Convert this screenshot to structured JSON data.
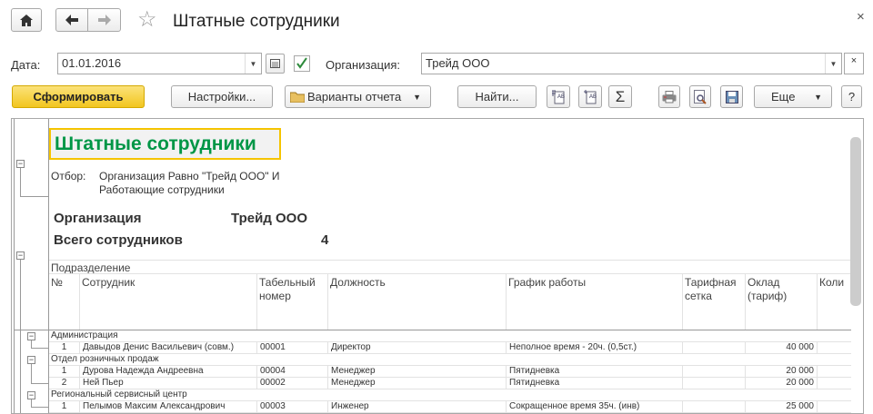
{
  "window": {
    "title": "Штатные сотрудники",
    "close": "×"
  },
  "icons": {
    "home": "home-icon",
    "back": "arrow-left-icon",
    "forward": "arrow-right-icon",
    "favorite": "star-icon"
  },
  "filters": {
    "date_label": "Дата:",
    "date_value": "01.01.2016",
    "org_checked": true,
    "org_label": "Организация:",
    "org_value": "Трейд ООО",
    "clear": "×"
  },
  "toolbar": {
    "generate": "Сформировать",
    "settings": "Настройки...",
    "variants": "Варианты отчета",
    "find": "Найти...",
    "more": "Еще",
    "help": "?",
    "accent": "#f5cd2c"
  },
  "report": {
    "title": "Штатные сотрудники",
    "title_color": "#009646",
    "filter_label": "Отбор:",
    "filter_line1": "Организация Равно \"Трейд ООО\" И",
    "filter_line2": "Работающие сотрудники",
    "org_label": "Организация",
    "org_value": "Трейд ООО",
    "total_label": "Всего сотрудников",
    "total_value": "4",
    "group_header": "Подразделение",
    "columns": [
      "№",
      "Сотрудник",
      "Табельный номер",
      "Должность",
      "График работы",
      "Тарифная сетка",
      "Оклад (тариф)",
      "Коли"
    ],
    "groups": [
      {
        "name": "Администрация",
        "rows": [
          [
            "1",
            "Давыдов Денис Васильевич (совм.)",
            "00001",
            "Директор",
            "Неполное время - 20ч. (0,5ст.)",
            "",
            "40 000"
          ]
        ]
      },
      {
        "name": "Отдел розничных продаж",
        "rows": [
          [
            "1",
            "Дурова Надежда Андреевна",
            "00004",
            "Менеджер",
            "Пятидневка",
            "",
            "20 000"
          ],
          [
            "2",
            "Ней Пьер",
            "00002",
            "Менеджер",
            "Пятидневка",
            "",
            "20 000"
          ]
        ]
      },
      {
        "name": "Региональный сервисный центр",
        "rows": [
          [
            "1",
            "Пелымов Максим Александрович",
            "00003",
            "Инженер",
            "Сокращенное время 35ч. (инв)",
            "",
            "25 000"
          ]
        ]
      }
    ]
  }
}
